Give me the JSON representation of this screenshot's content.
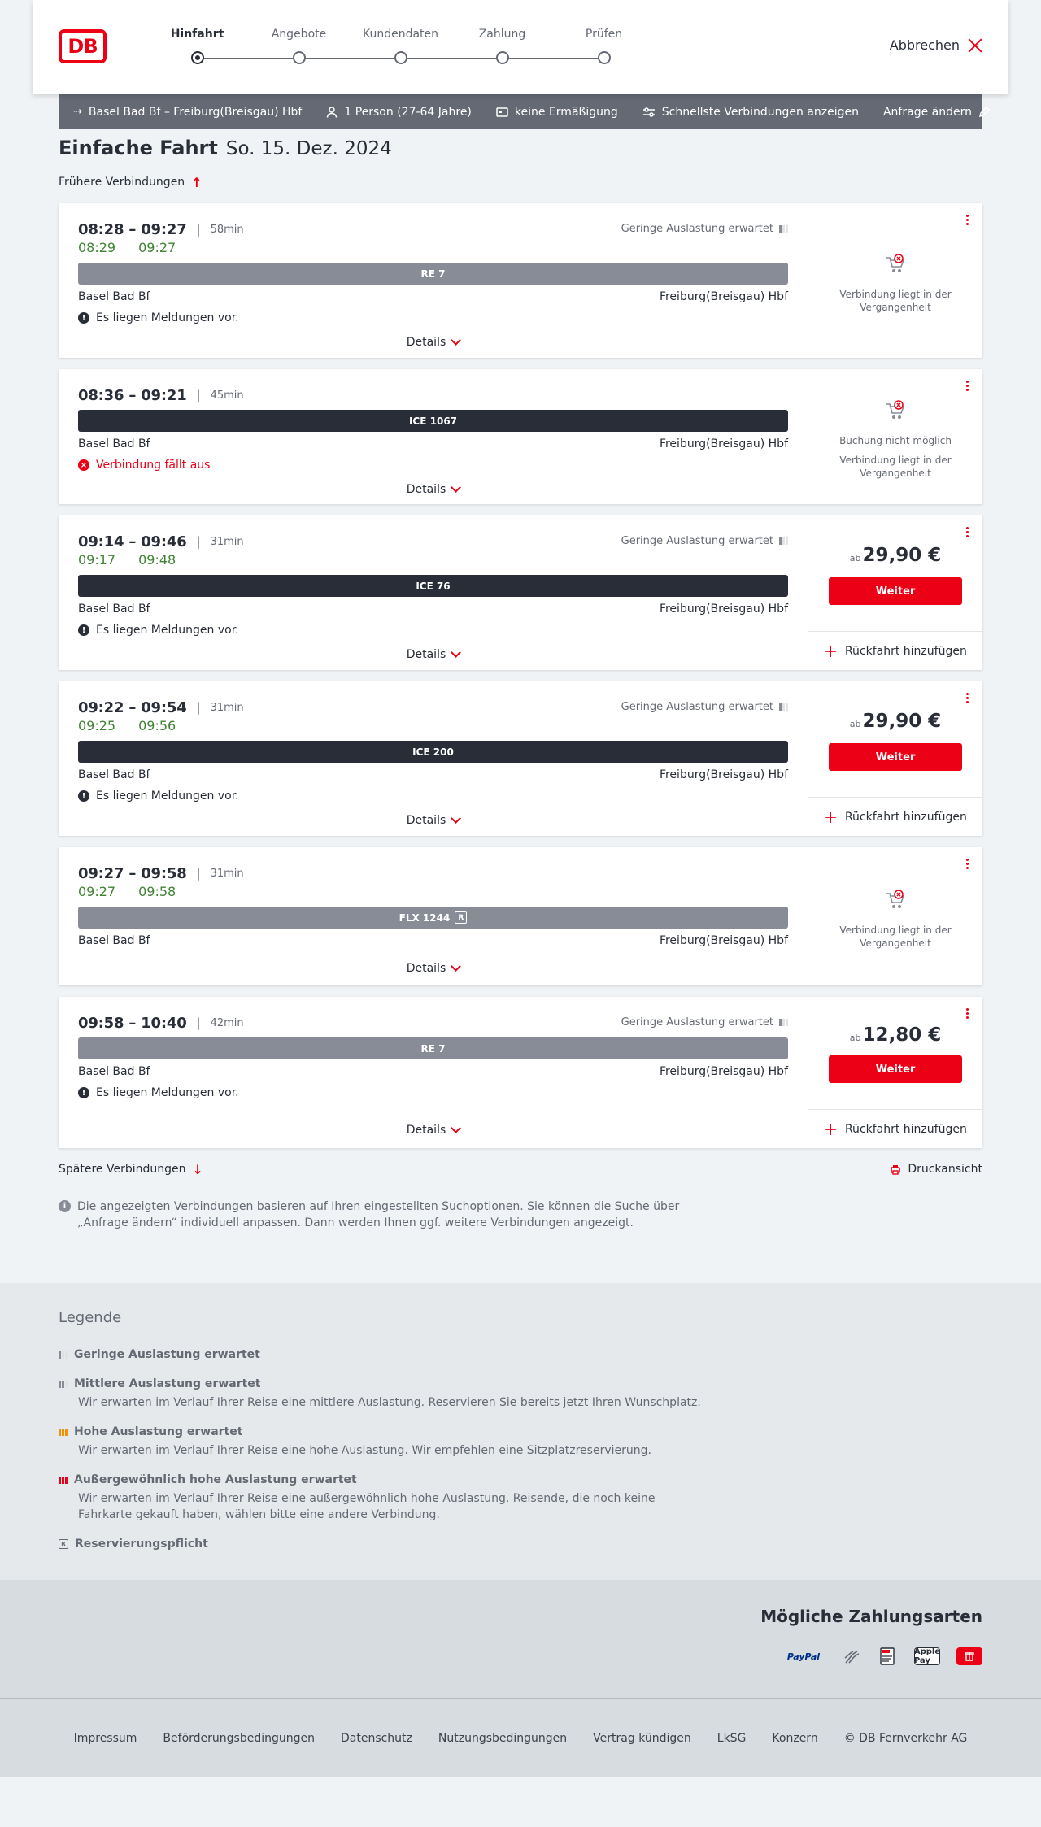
{
  "header": {
    "logo": "DB",
    "steps": [
      "Hinfahrt",
      "Angebote",
      "Kundendaten",
      "Zahlung",
      "Prüfen"
    ],
    "cancel": "Abbrechen"
  },
  "summary": {
    "route": "Basel Bad Bf – Freiburg(Breisgau) Hbf",
    "passengers": "1 Person (27-64 Jahre)",
    "discount": "keine Ermäßigung",
    "fastest": "Schnellste Verbindungen anzeigen",
    "change": "Anfrage ändern"
  },
  "page": {
    "title": "Einfache Fahrt",
    "date": "So. 15. Dez. 2024",
    "earlier": "Frühere Verbindungen",
    "later": "Spätere Verbindungen",
    "print": "Druckansicht",
    "info": "Die angezeigten Verbindungen basieren auf Ihren eingestellten Suchoptionen. Sie können die Suche über „Anfrage ändern“ individuell anpassen. Dann werden Ihnen ggf. weitere Verbindungen angezeigt.",
    "details": "Details",
    "weiter": "Weiter",
    "rueckfahrt": "Rückfahrt hinzufügen",
    "ab": "ab"
  },
  "connections": [
    {
      "times": "08:28 – 09:27",
      "duration": "58min",
      "rt_dep": "08:29",
      "rt_arr": "09:27",
      "load": "Geringe Auslastung erwartet",
      "train": "RE 7",
      "from": "Basel Bad Bf",
      "to": "Freiburg(Breisgau) Hbf",
      "message": "Es liegen Meldungen vor.",
      "note1": "Verbindung liegt in der Vergangenheit"
    },
    {
      "times": "08:36 – 09:21",
      "duration": "45min",
      "train": "ICE 1067",
      "from": "Basel Bad Bf",
      "to": "Freiburg(Breisgau) Hbf",
      "message": "Verbindung fällt aus",
      "note0": "Buchung nicht möglich",
      "note1": "Verbindung liegt in der Vergangenheit"
    },
    {
      "times": "09:14 – 09:46",
      "duration": "31min",
      "rt_dep": "09:17",
      "rt_arr": "09:48",
      "load": "Geringe Auslastung erwartet",
      "train": "ICE 76",
      "from": "Basel Bad Bf",
      "to": "Freiburg(Breisgau) Hbf",
      "message": "Es liegen Meldungen vor.",
      "price": "29,90 €"
    },
    {
      "times": "09:22 – 09:54",
      "duration": "31min",
      "rt_dep": "09:25",
      "rt_arr": "09:56",
      "load": "Geringe Auslastung erwartet",
      "train": "ICE 200",
      "from": "Basel Bad Bf",
      "to": "Freiburg(Breisgau) Hbf",
      "message": "Es liegen Meldungen vor.",
      "price": "29,90 €"
    },
    {
      "times": "09:27 – 09:58",
      "duration": "31min",
      "rt_dep": "09:27",
      "rt_arr": "09:58",
      "train": "FLX 1244",
      "train_badge": "R",
      "from": "Basel Bad Bf",
      "to": "Freiburg(Breisgau) Hbf",
      "note1": "Verbindung liegt in der Vergangenheit"
    },
    {
      "times": "09:58 – 10:40",
      "duration": "42min",
      "load": "Geringe Auslastung erwartet",
      "train": "RE 7",
      "from": "Basel Bad Bf",
      "to": "Freiburg(Breisgau) Hbf",
      "message": "Es liegen Meldungen vor.",
      "price": "12,80 €"
    }
  ],
  "legend": {
    "title": "Legende",
    "items": [
      {
        "title": "Geringe Auslastung erwartet"
      },
      {
        "title": "Mittlere Auslastung erwartet",
        "text": "Wir erwarten im Verlauf Ihrer Reise eine mittlere Auslastung. Reservieren Sie bereits jetzt Ihren Wunschplatz."
      },
      {
        "title": "Hohe Auslastung erwartet",
        "text": "Wir erwarten im Verlauf Ihrer Reise eine hohe Auslastung. Wir empfehlen eine Sitzplatzreservierung."
      },
      {
        "title": "Außergewöhnlich hohe Auslastung erwartet",
        "text": "Wir erwarten im Verlauf Ihrer Reise eine außergewöhnlich hohe Auslastung. Reisende, die noch keine Fahrkarte gekauft haben, wählen bitte eine andere Verbindung."
      },
      {
        "title": "Reservierungspflicht"
      }
    ]
  },
  "payment": {
    "title": "Mögliche Zahlungsarten",
    "methods": [
      "PayPal",
      "Kreditkarte",
      "SEPA",
      "Apple Pay",
      "DB"
    ]
  },
  "footer": {
    "links": [
      "Impressum",
      "Beförderungsbedingungen",
      "Datenschutz",
      "Nutzungsbedingungen",
      "Vertrag kündigen",
      "LkSG",
      "Konzern",
      "© DB Fernverkehr AG"
    ]
  },
  "colors": {
    "brand": "#ec0016",
    "realtime": "#408335",
    "bar_dark": "#282d37",
    "bar_grey": "#878c96"
  }
}
